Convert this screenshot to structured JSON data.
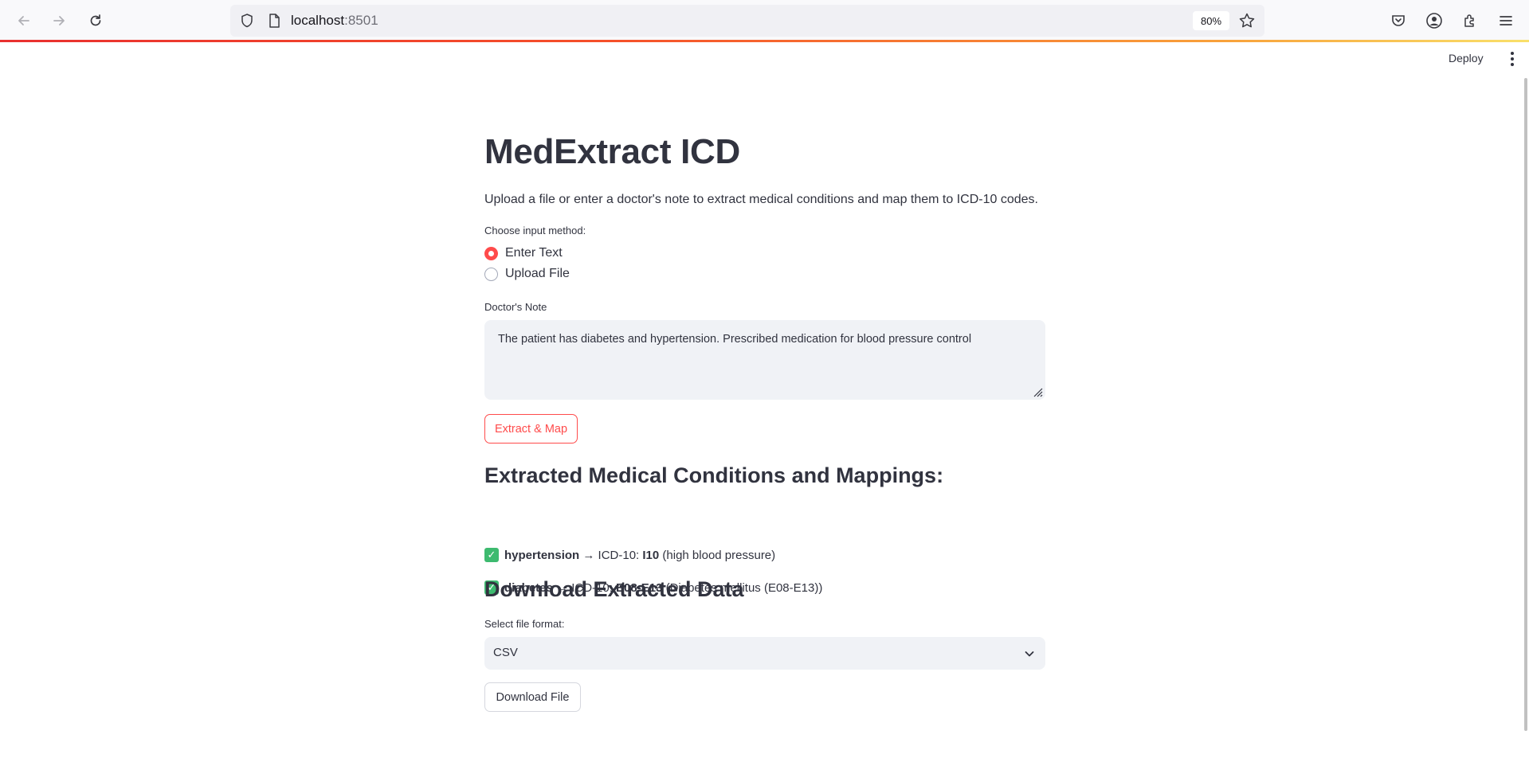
{
  "browser": {
    "url_host": "localhost",
    "url_port": ":8501",
    "zoom": "80%"
  },
  "app": {
    "deploy_label": "Deploy",
    "title": "MedExtract ICD",
    "subtitle": "Upload a file or enter a doctor's note to extract medical conditions and map them to ICD-10 codes.",
    "input_method": {
      "label": "Choose input method:",
      "options": [
        {
          "label": "Enter Text",
          "selected": true
        },
        {
          "label": "Upload File",
          "selected": false
        }
      ]
    },
    "note": {
      "label": "Doctor's Note",
      "value": "The patient has diabetes and hypertension. Prescribed medication for blood pressure control"
    },
    "extract_button": "Extract & Map",
    "results": {
      "heading": "Extracted Medical Conditions and Mappings:",
      "items": [
        {
          "condition": "hypertension",
          "arrow_text": " → ICD-10: ",
          "code": "I10",
          "description": " (high blood pressure)"
        },
        {
          "condition": "diabetes",
          "arrow_text": " → ICD-10: ",
          "code": "E08-E13",
          "description": " (Diabetes mellitus (E08-E13))"
        }
      ]
    },
    "download": {
      "heading": "Download Extracted Data",
      "format_label": "Select file format:",
      "format_value": "CSV",
      "button": "Download File"
    }
  },
  "colors": {
    "accent": "#ff4b4b",
    "check": "#3dba6f",
    "text": "#31333f",
    "input_bg": "#f0f2f6"
  },
  "icons": [
    "back-arrow-icon",
    "forward-arrow-icon",
    "reload-icon",
    "shield-icon",
    "page-icon",
    "star-icon",
    "pocket-icon",
    "account-icon",
    "extensions-icon",
    "menu-icon",
    "kebab-menu-icon",
    "check-icon",
    "chevron-down-icon",
    "resize-grip-icon"
  ]
}
